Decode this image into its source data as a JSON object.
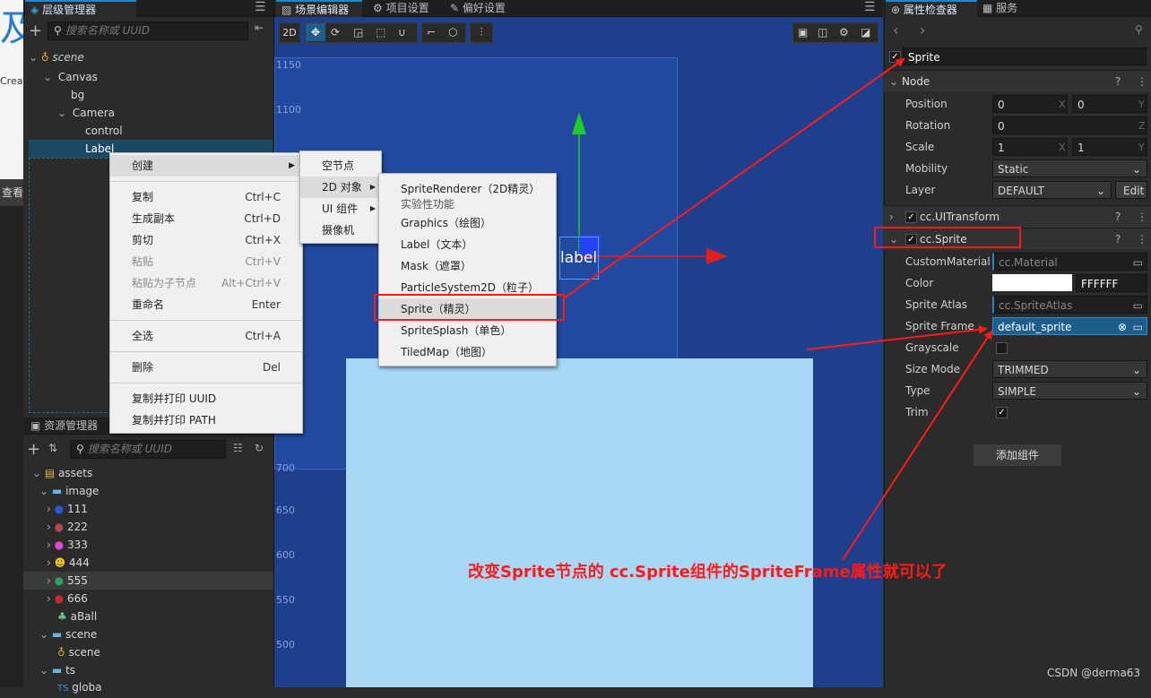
{
  "hierarchy": {
    "title": "层级管理器",
    "search_placeholder": "搜索名称或 UUID",
    "nodes": [
      "scene",
      "Canvas",
      "bg",
      "Camera",
      "control",
      "Label"
    ]
  },
  "scene_tabs": [
    "场景编辑器",
    "项目设置",
    "偏好设置"
  ],
  "scene_toolbar": {
    "mode": "2D"
  },
  "ruler": [
    "1150",
    "1100",
    "700",
    "650",
    "600",
    "550",
    "500"
  ],
  "gizmo_label": "label",
  "context_menu": {
    "items": [
      {
        "label": "创建",
        "shortcut": ""
      },
      {
        "label": "复制",
        "shortcut": "Ctrl+C"
      },
      {
        "label": "生成副本",
        "shortcut": "Ctrl+D"
      },
      {
        "label": "剪切",
        "shortcut": "Ctrl+X"
      },
      {
        "label": "粘贴",
        "shortcut": "Ctrl+V"
      },
      {
        "label": "粘贴为子节点",
        "shortcut": "Alt+Ctrl+V"
      },
      {
        "label": "重命名",
        "shortcut": "Enter"
      },
      {
        "label": "全选",
        "shortcut": "Ctrl+A"
      },
      {
        "label": "删除",
        "shortcut": "Del"
      },
      {
        "label": "复制并打印 UUID",
        "shortcut": ""
      },
      {
        "label": "复制并打印 PATH",
        "shortcut": ""
      }
    ]
  },
  "create_submenu": [
    "空节点",
    "2D 对象",
    "UI 组件",
    "摄像机"
  ],
  "object2d_submenu": [
    {
      "label": "SpriteRenderer（2D精灵）",
      "sub": "实验性功能"
    },
    {
      "label": "Graphics（绘图）"
    },
    {
      "label": "Label（文本）"
    },
    {
      "label": "Mask（遮罩）"
    },
    {
      "label": "ParticleSystem2D（粒子）"
    },
    {
      "label": "Sprite（精灵）"
    },
    {
      "label": "SpriteSplash（单色）"
    },
    {
      "label": "TiledMap（地图）"
    }
  ],
  "assets": {
    "title": "资源管理器",
    "search_placeholder": "搜索名称或 UUID",
    "items": [
      "assets",
      "image",
      "111",
      "222",
      "333",
      "444",
      "555",
      "666",
      "aBall",
      "scene",
      "scene",
      "ts",
      "globa"
    ]
  },
  "left_edge": {
    "text1": "Crea",
    "text2": "查看"
  },
  "inspector": {
    "tabs": [
      "属性检查器",
      "服务"
    ],
    "node_name": "Sprite",
    "node_section": "Node",
    "position": {
      "label": "Position",
      "x": "0",
      "y": "0",
      "xu": "X",
      "yu": "Y"
    },
    "rotation": {
      "label": "Rotation",
      "z": "0",
      "zu": "Z"
    },
    "scale": {
      "label": "Scale",
      "x": "1",
      "y": "1",
      "xu": "X",
      "yu": "Y"
    },
    "mobility": {
      "label": "Mobility",
      "value": "Static"
    },
    "layer": {
      "label": "Layer",
      "value": "DEFAULT",
      "edit": "Edit"
    },
    "uitransform": "cc.UITransform",
    "sprite_component": "cc.Sprite",
    "custom_material": {
      "label": "CustomMaterial",
      "value": "cc.Material"
    },
    "color": {
      "label": "Color",
      "hex": "FFFFFF"
    },
    "sprite_atlas": {
      "label": "Sprite Atlas",
      "value": "cc.SpriteAtlas"
    },
    "sprite_frame": {
      "label": "Sprite Frame",
      "value": "default_sprite"
    },
    "grayscale": {
      "label": "Grayscale"
    },
    "size_mode": {
      "label": "Size Mode",
      "value": "TRIMMED"
    },
    "type": {
      "label": "Type",
      "value": "SIMPLE"
    },
    "trim": {
      "label": "Trim"
    },
    "add_component": "添加组件"
  },
  "annotation": "改变Sprite节点的 cc.Sprite组件的SpriteFrame属性就可以了",
  "watermark": "CSDN @derma63",
  "colors": {
    "accent": "#1e88c8",
    "annotation_red": "#ff1a1a",
    "scene_bg": "#1e3f8c",
    "light_rect": "#a9d8f7"
  }
}
